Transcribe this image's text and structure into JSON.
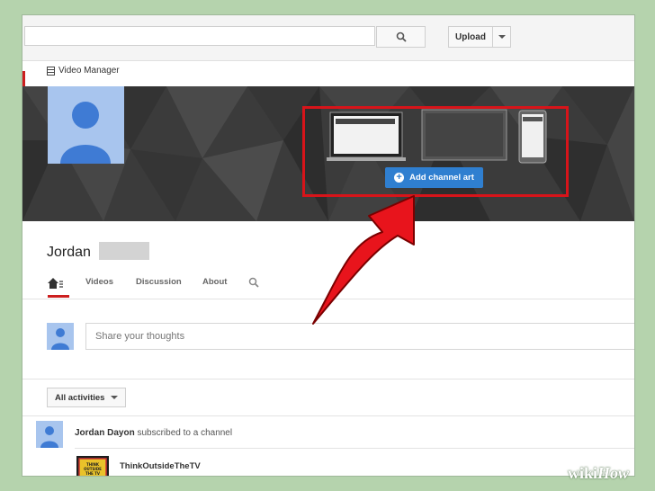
{
  "header": {
    "search_placeholder": "",
    "upload_label": "Upload"
  },
  "sidebar": {
    "video_manager_label": "Video Manager"
  },
  "banner": {
    "add_channel_art_label": "Add channel art"
  },
  "channel": {
    "name": "Jordan"
  },
  "tabs": {
    "items": [
      {
        "label": "Videos"
      },
      {
        "label": "Discussion"
      },
      {
        "label": "About"
      }
    ]
  },
  "share": {
    "placeholder": "Share your thoughts"
  },
  "activities": {
    "filter_label": "All activities"
  },
  "feed": {
    "user": "Jordan Dayon",
    "action": "subscribed to a channel",
    "channel_name": "ThinkOutsideTheTV",
    "thumb_text": "THINK OUTSIDE THE TV"
  },
  "watermark": {
    "wiki": "wiki",
    "how": "How"
  },
  "colors": {
    "highlight_red": "#d7141a",
    "button_blue": "#2f7fd0",
    "avatar_blue": "#a8c5ee"
  }
}
